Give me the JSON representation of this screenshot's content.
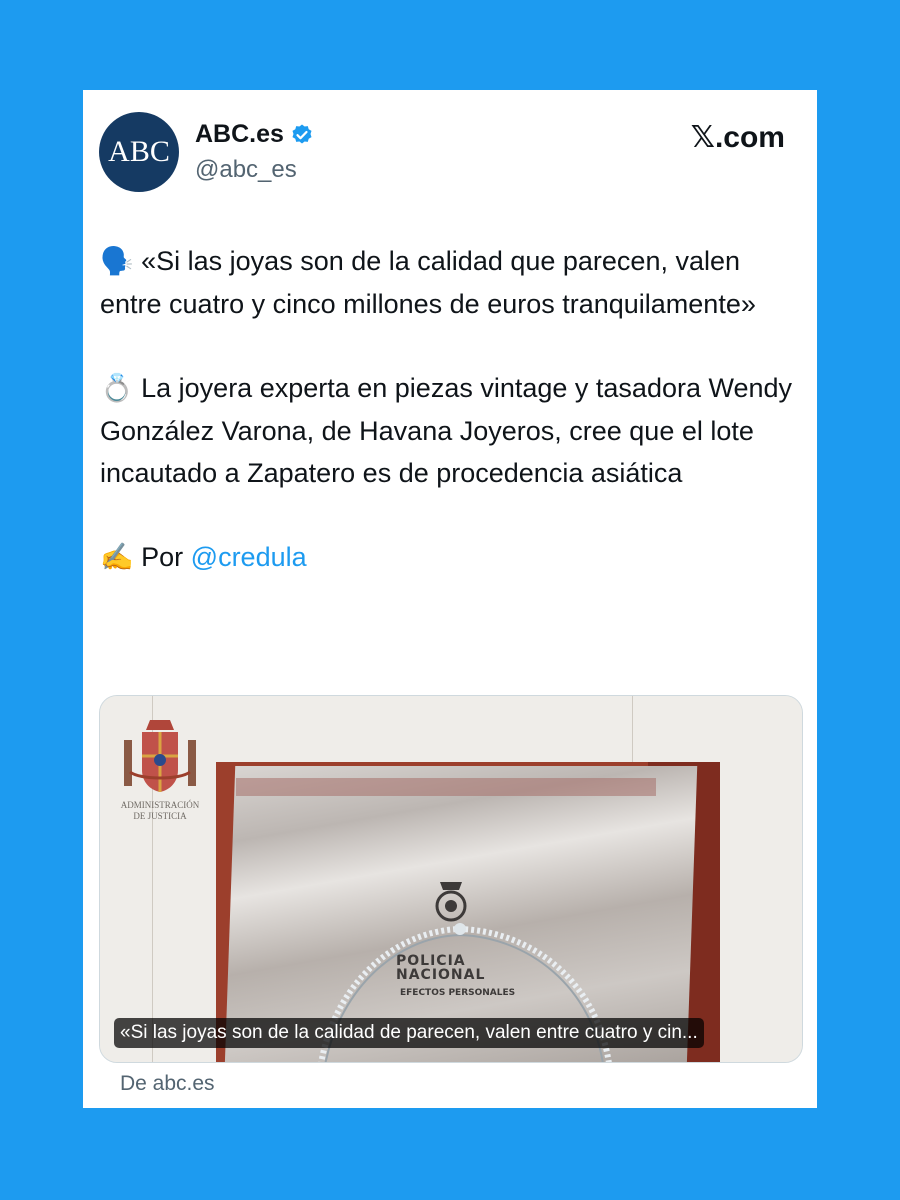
{
  "account": {
    "name": "ABC.es",
    "handle": "@abc_es",
    "avatar_text": "ABC",
    "verified": true
  },
  "platform": {
    "logo_text": "𝕏.com"
  },
  "post": {
    "para1_emoji": "🗣️",
    "para1_text": " «Si las joyas son de la calidad que parecen, valen entre cuatro y cinco millones de euros tranquilamente»",
    "para2_emoji": "💍",
    "para2_text": " La joyera experta en piezas vintage y tasadora Wendy González Varona, de Havana Joyeros, cree que el lote incautado a Zapatero es de procedencia asiática",
    "para3_emoji": "✍️",
    "para3_prefix": " Por ",
    "mention": "@credula"
  },
  "media_card": {
    "document_header": "Administración de Justicia",
    "bag_label_line1": "POLICIA",
    "bag_label_line2": "NACIONAL",
    "bag_label_line3": "EFECTOS PERSONALES",
    "caption": "«Si las joyas son de la calidad de parecen, valen entre cuatro y cin...",
    "source": "De abc.es"
  },
  "colors": {
    "background": "#1d9bf0",
    "avatar": "#153a63",
    "mention": "#1d9bf0",
    "verified_badge": "#1d9bf0"
  }
}
